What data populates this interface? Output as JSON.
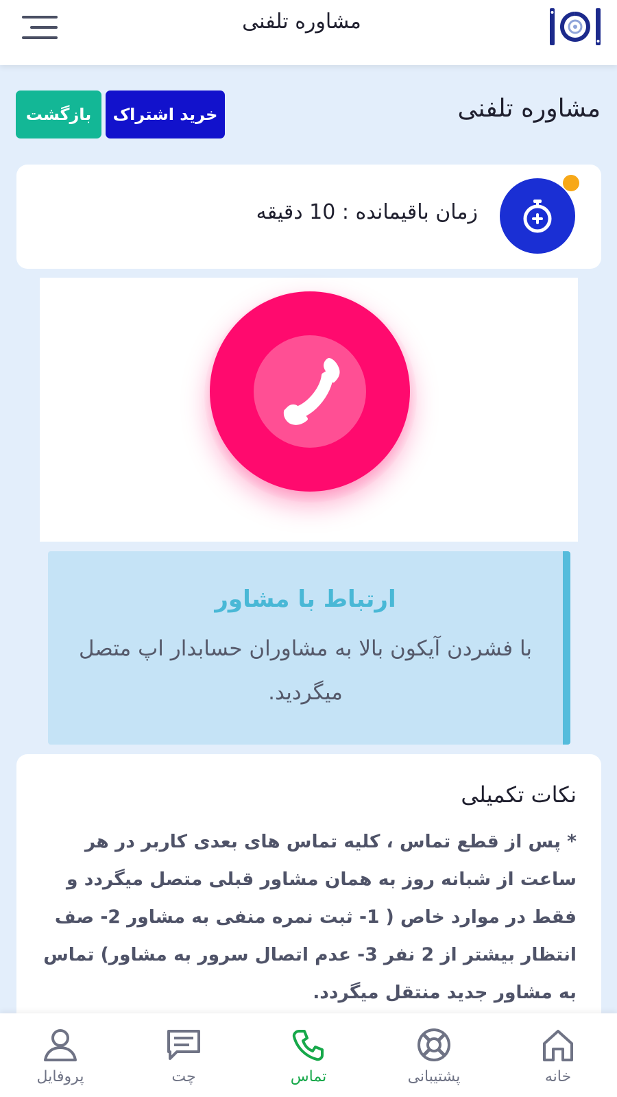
{
  "header": {
    "title": "مشاوره تلفنی",
    "menu_icon": "hamburger-menu-icon",
    "logo_icon": "app-logo"
  },
  "page": {
    "heading": "مشاوره تلفنی",
    "buy_label": "خرید اشتراک",
    "back_label": "بازگشت"
  },
  "timer": {
    "icon": "stopwatch-icon",
    "text": "زمان باقیمانده : 10 دقیقه"
  },
  "call": {
    "icon": "phone-icon"
  },
  "info": {
    "title": "ارتباط با مشاور",
    "body": "با فشردن آیکون بالا به مشاوران حسابدار اپ متصل میگردید."
  },
  "notes": {
    "title": "نکات تکمیلی",
    "body": "* پس از قطع تماس ، کلیه تماس های بعدی کاربر در هر ساعت از شبانه روز به همان مشاور قبلی متصل میگردد و فقط در موارد خاص ( 1- ثبت نمره منفی به مشاور 2- صف انتظار بیشتر از 2 نفر 3- عدم اتصال سرور به مشاور) تماس به مشاور جدید منتقل میگردد."
  },
  "nav": {
    "items": [
      {
        "label": "خانه",
        "icon": "home-icon"
      },
      {
        "label": "پشتیبانی",
        "icon": "lifebuoy-icon"
      },
      {
        "label": "تماس",
        "icon": "phone-icon",
        "active": true
      },
      {
        "label": "چت",
        "icon": "chat-icon"
      },
      {
        "label": "پروفایل",
        "icon": "user-icon"
      }
    ]
  },
  "colors": {
    "background": "#e3eefb",
    "primary_blue": "#1212cc",
    "back_green": "#13b796",
    "call_pink": "#ff0a6e",
    "info_accent": "#55bcdc",
    "active_nav": "#17a84a",
    "timer_dot": "#f7a818"
  }
}
